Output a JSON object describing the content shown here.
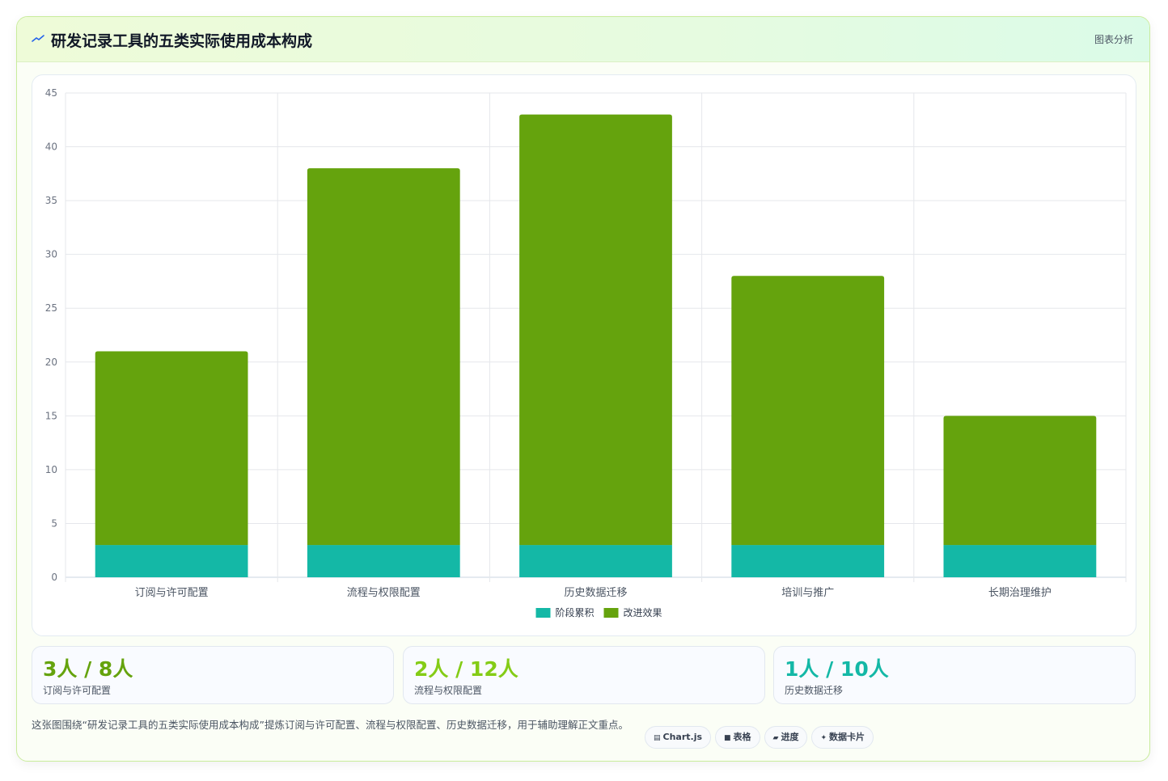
{
  "header": {
    "title": "研发记录工具的五类实际使用成本构成",
    "tag": "图表分析"
  },
  "colors": {
    "accent_green": "#65a30d",
    "accent_teal": "#14b8a6",
    "stat_value_1": "#65a30d",
    "stat_value_2": "#84cc16",
    "stat_value_3": "#14b8a6"
  },
  "chart_data": {
    "type": "bar",
    "stacked": true,
    "categories": [
      "订阅与许可配置",
      "流程与权限配置",
      "历史数据迁移",
      "培训与推广",
      "长期治理维护"
    ],
    "series": [
      {
        "name": "阶段累积",
        "values": [
          3,
          3,
          3,
          3,
          3
        ],
        "color": "#14b8a6"
      },
      {
        "name": "改进效果",
        "values": [
          18,
          35,
          40,
          25,
          12
        ],
        "color": "#65a30d"
      }
    ],
    "ylim": [
      0,
      45
    ],
    "yticks": [
      0,
      5,
      10,
      15,
      20,
      25,
      30,
      35,
      40,
      45
    ],
    "grid": true,
    "legend": "bottom"
  },
  "stats": [
    {
      "value": "3人 / 8人",
      "label": "订阅与许可配置"
    },
    {
      "value": "2人 / 12人",
      "label": "流程与权限配置"
    },
    {
      "value": "1人 / 10人",
      "label": "历史数据迁移"
    }
  ],
  "note": "这张图围绕“研发记录工具的五类实际使用成本构成”提炼订阅与许可配置、流程与权限配置、历史数据迁移，用于辅助理解正文重点。",
  "pills": [
    {
      "icon": "chart-icon",
      "label": "Chart.js"
    },
    {
      "icon": "table-icon",
      "label": "表格"
    },
    {
      "icon": "progress-icon",
      "label": "进度"
    },
    {
      "icon": "sparkle-icon",
      "label": "数据卡片"
    }
  ]
}
